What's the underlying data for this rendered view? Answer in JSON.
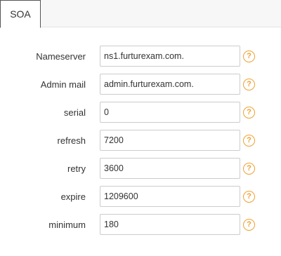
{
  "tabs": [
    {
      "label": "SOA"
    }
  ],
  "fields": [
    {
      "key": "nameserver",
      "label": "Nameserver",
      "value": "ns1.furturexam.com."
    },
    {
      "key": "admin_mail",
      "label": "Admin mail",
      "value": "admin.furturexam.com."
    },
    {
      "key": "serial",
      "label": "serial",
      "value": "0"
    },
    {
      "key": "refresh",
      "label": "refresh",
      "value": "7200"
    },
    {
      "key": "retry",
      "label": "retry",
      "value": "3600"
    },
    {
      "key": "expire",
      "label": "expire",
      "value": "1209600"
    },
    {
      "key": "minimum",
      "label": "minimum",
      "value": "180"
    }
  ],
  "help_glyph": "?",
  "help_icon": "question-circle-icon",
  "colors": {
    "help": "#f0a030",
    "border": "#cccccc",
    "active_tab_border": "#555555"
  }
}
